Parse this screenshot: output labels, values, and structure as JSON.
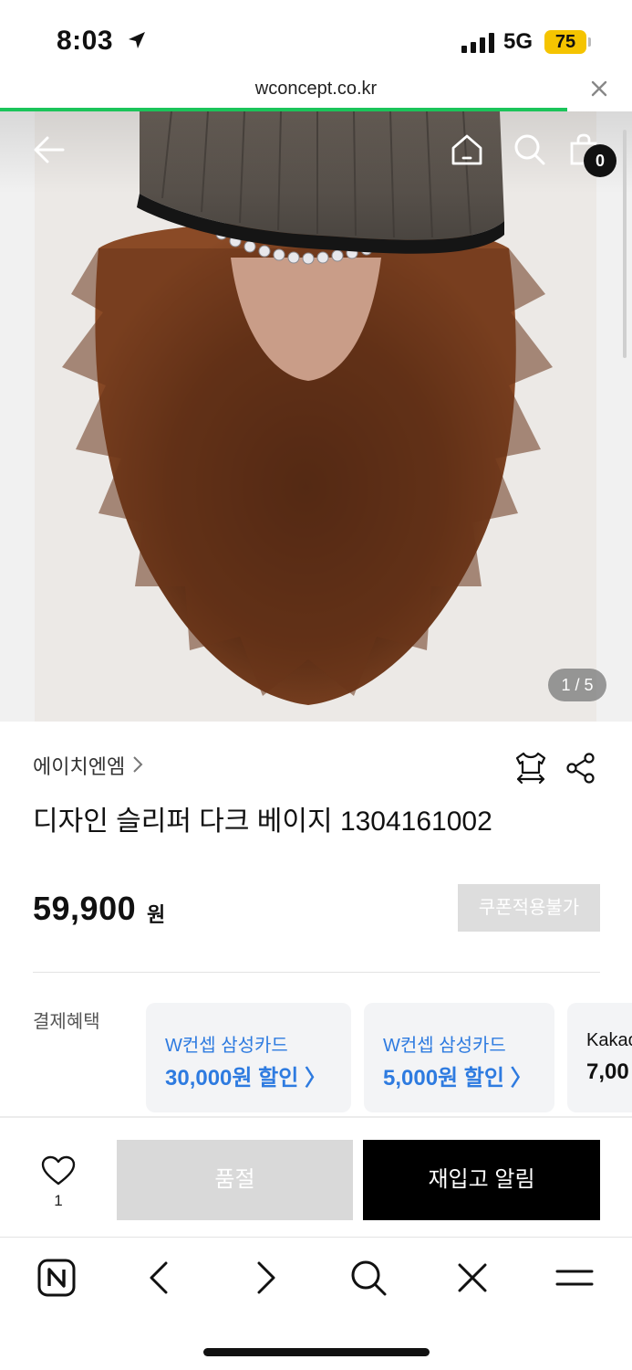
{
  "status_bar": {
    "time": "8:03",
    "network": "5G",
    "battery": "75"
  },
  "browser": {
    "url": "wconcept.co.kr"
  },
  "gallery": {
    "counter": "1 / 5",
    "cart_count": "0"
  },
  "product": {
    "brand": "에이치엔엠",
    "title": "디자인 슬리퍼 다크 베이지 1304161002",
    "price": "59,900",
    "currency": "원",
    "coupon_label": "쿠폰적용불가"
  },
  "benefits": {
    "label": "결제혜택",
    "cards": [
      {
        "line1": "W컨셉 삼성카드",
        "line2": "30,000원 할인 〉"
      },
      {
        "line1": "W컨셉 삼성카드",
        "line2": "5,000원 할인 〉"
      },
      {
        "line1": "Kakao",
        "line2": "7,00"
      }
    ]
  },
  "actions": {
    "like_count": "1",
    "soldout_label": "품절",
    "restock_label": "재입고 알림"
  },
  "colors": {
    "accent_blue": "#2e7be0",
    "progress_green": "#1bc45a",
    "battery_yellow": "#f5c400"
  }
}
